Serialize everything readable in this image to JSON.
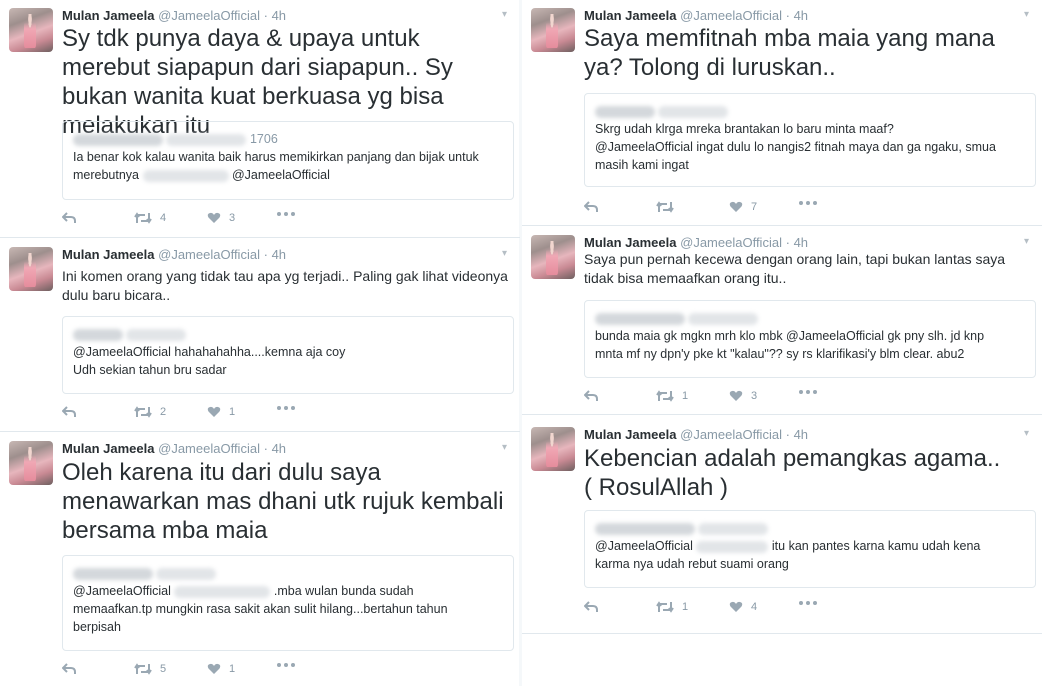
{
  "tweets": [
    {
      "name": "Mulan Jameela",
      "handle": "@JameelaOfficial",
      "dot": "·",
      "time": "4h",
      "text": "Sy tdk punya daya & upaya untuk merebut siapapun dari siapapun.. Sy bukan wanita kuat berkuasa yg bisa melakukan itu",
      "quote_head_tail": "1706",
      "quote_lines": [
        "Ia benar kok kalau wanita baik harus memikirkan panjang dan bijak untuk",
        "merebutnya",
        "@JameelaOfficial"
      ],
      "retweets": "4",
      "likes": "3"
    },
    {
      "name": "Mulan Jameela",
      "handle": "@JameelaOfficial",
      "dot": "·",
      "time": "4h",
      "text": "Ini komen orang yang tidak tau apa yg terjadi.. Paling gak lihat videonya dulu baru bicara..",
      "quote_lines": [
        "@JameelaOfficial hahahahahha....kemna aja coy",
        "Udh sekian tahun bru sadar"
      ],
      "retweets": "2",
      "likes": "1"
    },
    {
      "name": "Mulan Jameela",
      "handle": "@JameelaOfficial",
      "dot": "·",
      "time": "4h",
      "text": "Oleh karena itu dari dulu saya menawarkan mas dhani utk rujuk kembali bersama mba maia",
      "quote_lines": [
        "@JameelaOfficial",
        ".mba wulan bunda sudah",
        "memaafkan.tp mungkin rasa sakit akan sulit hilang...bertahun tahun",
        "berpisah"
      ],
      "retweets": "5",
      "likes": "1"
    },
    {
      "text": "Saya memfitnah mba maia yang mana ya? Tolong di luruskan..",
      "name": "Mulan Jameela",
      "handle": "@JameelaOfficial",
      "dot": "·",
      "time": "4h",
      "quote_lines": [
        "Skrg udah klrga mreka brantakan lo baru minta maaf?",
        "@JameelaOfficial ingat dulu lo nangis2 fitnah maya dan ga ngaku, smua",
        "masih kami ingat"
      ],
      "retweets": "",
      "likes": "7"
    },
    {
      "name": "Mulan Jameela",
      "handle": "@JameelaOfficial",
      "dot": "·",
      "time": "4h",
      "text": "Saya pun pernah kecewa dengan orang lain, tapi bukan lantas saya tidak bisa memaafkan orang itu..",
      "quote_lines": [
        "bunda maia gk mgkn mrh klo mbk @JameelaOfficial gk pny slh. jd knp",
        "mnta mf ny dpn'y pke kt \"kalau\"?? sy rs klarifikasi'y blm clear. abu2"
      ],
      "retweets": "1",
      "likes": "3"
    },
    {
      "name": "Mulan Jameela",
      "handle": "@JameelaOfficial",
      "dot": "·",
      "time": "4h",
      "text": "Kebencian adalah pemangkas agama.. ( RosulAllah )",
      "quote_lines": [
        "@JameelaOfficial",
        "itu kan pantes karna kamu udah kena",
        "karma nya udah rebut suami orang"
      ],
      "retweets": "1",
      "likes": "4"
    }
  ],
  "icons": {
    "reply": "reply-icon",
    "retweet": "retweet-icon",
    "like": "heart-icon",
    "more": "more-icon",
    "caret": "caret-icon"
  },
  "colors": {
    "text": "#292f33",
    "muted": "#8899a6",
    "border": "#e1e8ed",
    "icon": "#9aa8b3"
  }
}
